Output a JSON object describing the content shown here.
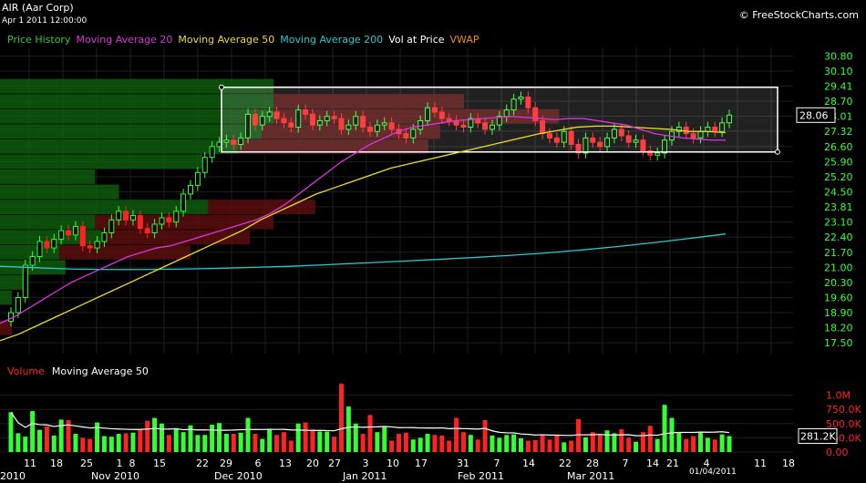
{
  "header": {
    "title": "AIR (Aar Corp)",
    "timestamp": "Apr 1 2011 12:00:00",
    "credit": "© FreeStockCharts.com"
  },
  "legend": [
    {
      "label": "Price History",
      "color": "#33cc33"
    },
    {
      "label": "Moving Average 20",
      "color": "#dd33dd"
    },
    {
      "label": "Moving Average 50",
      "color": "#eedd22"
    },
    {
      "label": "Moving Average 200",
      "color": "#22cccc"
    },
    {
      "label": "Vol at Price",
      "color": "#ffffff"
    },
    {
      "label": "VWAP",
      "color": "#ff8800"
    }
  ],
  "volume_legend": [
    {
      "label": "Volume",
      "color": "#ff2222"
    },
    {
      "label": "Moving Average 50",
      "color": "#ffffff"
    }
  ],
  "colors": {
    "up": "#33ff33",
    "down": "#ff2222",
    "ma20": "#dd33dd",
    "ma50": "#eedd22",
    "ma200": "#22cccc",
    "vwap": "#ff8800",
    "axis_text": "#ff2222",
    "price_text": "#33ff33"
  },
  "chart_data": [
    {
      "type": "candlestick",
      "title": "AIR (Aar Corp)",
      "y_ticks": [
        "30.80",
        "30.10",
        "29.41",
        "28.70",
        "28.01",
        "27.32",
        "26.60",
        "25.90",
        "25.20",
        "24.50",
        "23.81",
        "23.10",
        "22.40",
        "21.70",
        "21.00",
        "20.30",
        "19.60",
        "18.90",
        "18.20",
        "17.50"
      ],
      "y_tick_values": [
        30.8,
        30.1,
        29.41,
        28.7,
        28.01,
        27.32,
        26.6,
        25.9,
        25.2,
        24.5,
        23.81,
        23.1,
        22.4,
        21.7,
        21.0,
        20.3,
        19.6,
        18.9,
        18.2,
        17.5
      ],
      "ylim": [
        17.0,
        31.2
      ],
      "last_price": "28.06",
      "x_day_labels": [
        "11",
        "18",
        "25",
        "1",
        "8",
        "15",
        "22",
        "29",
        "6",
        "13",
        "20",
        "27",
        "3",
        "10",
        "17",
        "31",
        "7",
        "14",
        "22",
        "28",
        "7",
        "14",
        "21",
        "4",
        "11",
        "18"
      ],
      "x_month_labels": [
        "2010",
        "Nov 2010",
        "Dec 2010",
        "Jan 2011",
        "Feb 2011",
        "Mar 2011"
      ],
      "date_readout": "01/04/2011",
      "closes": [
        18.9,
        19.6,
        21.1,
        21.5,
        22.2,
        21.9,
        22.3,
        22.7,
        22.5,
        22.9,
        22.0,
        21.9,
        22.2,
        22.6,
        23.2,
        23.6,
        23.2,
        23.4,
        22.8,
        22.6,
        23.0,
        23.3,
        23.1,
        23.6,
        24.4,
        24.8,
        25.4,
        26.1,
        26.6,
        26.8,
        26.9,
        26.7,
        27.0,
        28.1,
        27.6,
        28.0,
        28.2,
        27.9,
        27.7,
        27.5,
        28.3,
        28.1,
        27.6,
        27.8,
        28.0,
        27.9,
        27.4,
        27.6,
        28.0,
        27.5,
        27.3,
        27.6,
        27.7,
        27.4,
        27.2,
        27.0,
        27.4,
        27.8,
        28.4,
        28.2,
        27.9,
        27.8,
        27.6,
        27.5,
        27.9,
        27.7,
        27.4,
        27.6,
        28.0,
        28.3,
        28.8,
        28.9,
        28.4,
        27.8,
        27.2,
        27.0,
        26.8,
        27.3,
        26.7,
        26.3,
        27.0,
        26.8,
        26.6,
        27.0,
        27.4,
        27.1,
        26.8,
        26.9,
        26.4,
        26.2,
        26.3,
        26.9,
        27.3,
        27.5,
        27.2,
        27.0,
        27.3,
        27.5,
        27.3,
        27.7,
        28.06
      ],
      "ma20": [
        18.4,
        18.7,
        19.1,
        19.5,
        19.9,
        20.3,
        20.6,
        20.9,
        21.2,
        21.5,
        21.7,
        21.9,
        22.0,
        22.2,
        22.4,
        22.6,
        22.8,
        23.0,
        23.2,
        23.5,
        23.9,
        24.4,
        24.9,
        25.4,
        25.9,
        26.3,
        26.7,
        27.0,
        27.3,
        27.5,
        27.6,
        27.7,
        27.8,
        27.85,
        27.9,
        27.95,
        28.0,
        27.95,
        27.9,
        27.85,
        27.9,
        27.9,
        27.8,
        27.7,
        27.6,
        27.4,
        27.2,
        27.1,
        27.0,
        26.95,
        26.9,
        26.9
      ],
      "ma50": [
        17.6,
        17.9,
        18.3,
        18.7,
        19.1,
        19.5,
        19.9,
        20.3,
        20.7,
        21.1,
        21.5,
        21.9,
        22.3,
        22.7,
        23.2,
        23.6,
        24.0,
        24.4,
        24.7,
        25.0,
        25.3,
        25.6,
        25.8,
        26.0,
        26.2,
        26.4,
        26.6,
        26.8,
        27.0,
        27.2,
        27.35,
        27.5,
        27.55,
        27.55,
        27.5,
        27.45,
        27.4,
        27.3,
        27.3,
        27.25
      ],
      "ma200": [
        21.05,
        20.98,
        20.92,
        20.9,
        20.9,
        20.92,
        20.95,
        21.0,
        21.05,
        21.12,
        21.2,
        21.28,
        21.36,
        21.45,
        21.55,
        21.66,
        21.8,
        21.96,
        22.14,
        22.34,
        22.55
      ],
      "vol_at_price": [
        {
          "price": 29.4,
          "up": 0.46,
          "down": 0.0
        },
        {
          "price": 28.7,
          "up": 0.46,
          "down": 0.32
        },
        {
          "price": 28.0,
          "up": 0.46,
          "down": 0.48
        },
        {
          "price": 27.3,
          "up": 0.44,
          "down": 0.3
        },
        {
          "price": 26.6,
          "up": 0.4,
          "down": 0.32
        },
        {
          "price": 25.9,
          "up": 0.34,
          "down": 0.0
        },
        {
          "price": 25.2,
          "up": 0.16,
          "down": 0.0
        },
        {
          "price": 24.5,
          "up": 0.2,
          "down": 0.0
        },
        {
          "price": 23.8,
          "up": 0.35,
          "down": 0.18
        },
        {
          "price": 23.1,
          "up": 0.16,
          "down": 0.3
        },
        {
          "price": 22.4,
          "up": 0.17,
          "down": 0.25
        },
        {
          "price": 21.7,
          "up": 0.1,
          "down": 0.22
        },
        {
          "price": 21.0,
          "up": 0.11,
          "down": 0.0
        },
        {
          "price": 20.3,
          "up": 0.04,
          "down": 0.0
        },
        {
          "price": 19.6,
          "up": 0.02,
          "down": 0.0
        },
        {
          "price": 18.9,
          "up": 0.0,
          "down": 0.0
        },
        {
          "price": 18.2,
          "up": 0.0,
          "down": 0.02
        }
      ]
    },
    {
      "type": "bar",
      "title": "Volume",
      "y_ticks": [
        "1.0M",
        "750.0K",
        "500.0K",
        "250.0K",
        "0.00"
      ],
      "y_tick_values": [
        1000000,
        750000,
        500000,
        250000,
        0
      ],
      "ylim": [
        0,
        1250000
      ],
      "last_volume": "281.2K",
      "values": [
        700,
        330,
        270,
        720,
        390,
        450,
        290,
        570,
        560,
        320,
        250,
        230,
        520,
        280,
        270,
        320,
        330,
        340,
        400,
        550,
        600,
        500,
        300,
        420,
        350,
        470,
        300,
        300,
        480,
        510,
        320,
        320,
        340,
        600,
        320,
        230,
        400,
        300,
        350,
        200,
        500,
        520,
        400,
        360,
        360,
        270,
        1200,
        800,
        500,
        320,
        650,
        350,
        450,
        200,
        320,
        340,
        220,
        250,
        320,
        300,
        290,
        200,
        600,
        350,
        300,
        220,
        560,
        290,
        250,
        300,
        310,
        240,
        200,
        210,
        300,
        220,
        290,
        170,
        200,
        580,
        260,
        350,
        300,
        380,
        330,
        400,
        250,
        180,
        350,
        460,
        230,
        830,
        600,
        340,
        230,
        280,
        350,
        250,
        220,
        310,
        281
      ]
    }
  ]
}
